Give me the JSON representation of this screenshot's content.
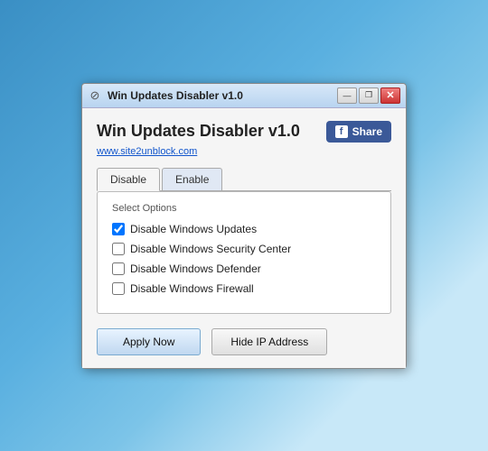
{
  "desktop": {
    "bg_color": "#4a9fd4"
  },
  "window": {
    "title": "Win Updates Disabler v1.0",
    "title_icon": "⊘",
    "controls": {
      "minimize": "—",
      "restore": "❐",
      "close": "✕"
    }
  },
  "header": {
    "app_title": "Win Updates Disabler v1.0",
    "website_url": "www.site2unblock.com",
    "share_btn": {
      "label": "Share",
      "fb_letter": "f"
    }
  },
  "tabs": [
    {
      "label": "Disable",
      "active": true
    },
    {
      "label": "Enable",
      "active": false
    }
  ],
  "options": {
    "legend": "Select Options",
    "items": [
      {
        "label": "Disable Windows Updates",
        "checked": true
      },
      {
        "label": "Disable Windows Security Center",
        "checked": false
      },
      {
        "label": "Disable Windows Defender",
        "checked": false
      },
      {
        "label": "Disable Windows Firewall",
        "checked": false
      }
    ]
  },
  "buttons": {
    "apply": "Apply Now",
    "hide_ip": "Hide IP Address"
  }
}
